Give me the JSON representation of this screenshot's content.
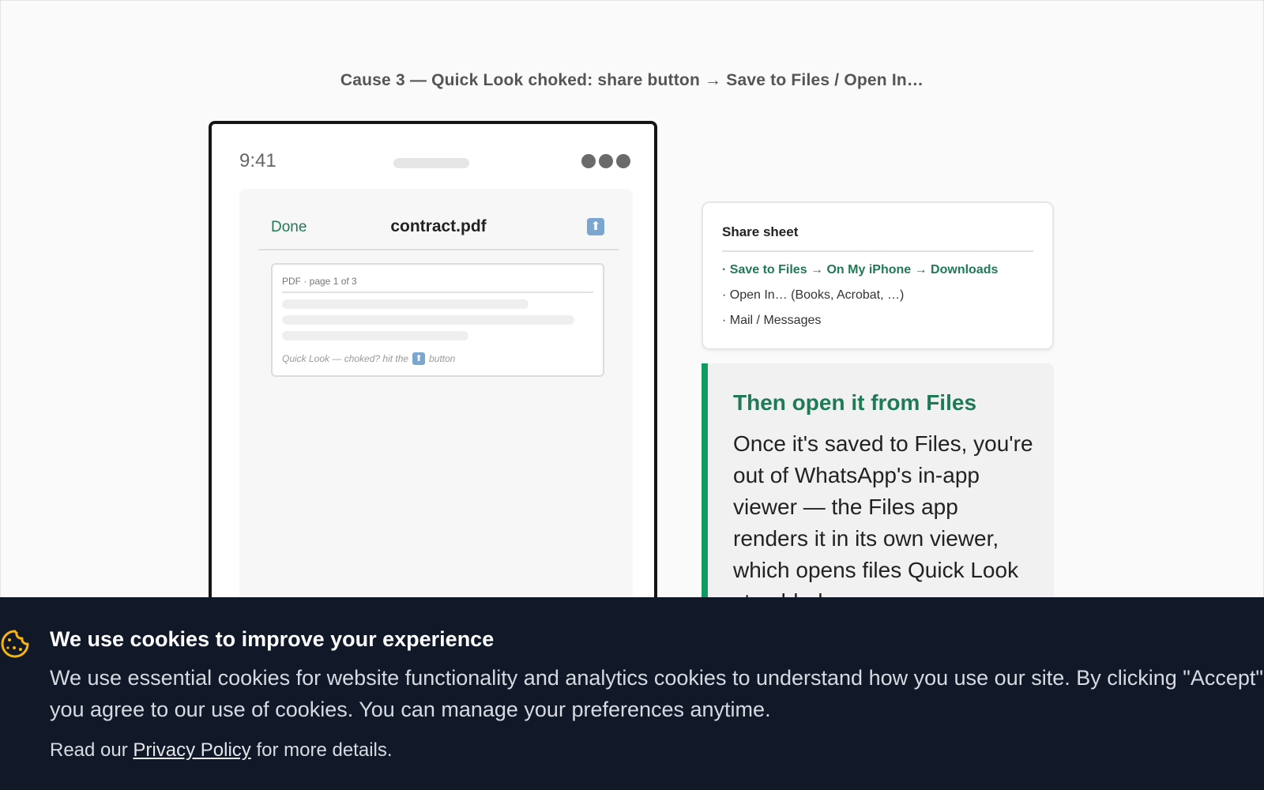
{
  "caption": "Cause 3 — Quick Look choked: share button → Save to Files / Open In…",
  "phone": {
    "time": "9:41",
    "nav": {
      "done_label": "Done",
      "title": "contract.pdf",
      "share_icon": "share-icon"
    },
    "page": {
      "label": "PDF · page 1 of 3",
      "hint_before": "Quick Look — choked? hit the",
      "hint_after": "button"
    }
  },
  "share_sheet": {
    "heading": "Share sheet",
    "options": [
      "· Save to Files → On My iPhone → Downloads",
      "· Open In… (Books, Acrobat, …)",
      "· Mail / Messages"
    ]
  },
  "callout": {
    "title": "Then open it from Files",
    "body": "Once it's saved to Files, you're out of WhatsApp's in-app viewer — the Files app renders it in its own viewer, which opens files Quick Look stumbled on."
  },
  "cookie_banner": {
    "icon": "cookie-icon",
    "title": "We use cookies to improve your experience",
    "body": "We use essential cookies for website functionality and analytics cookies to understand how you use our site. By clicking \"Accept\", you agree to our use of cookies. You can manage your preferences anytime.",
    "read_prefix": "Read our",
    "link_label": "Privacy Policy",
    "read_suffix": "for more details."
  },
  "colors": {
    "accent_green": "#1f7a55",
    "callout_bar": "#139a63",
    "banner_bg": "#111827",
    "cookie_icon": "#f5b50a"
  }
}
